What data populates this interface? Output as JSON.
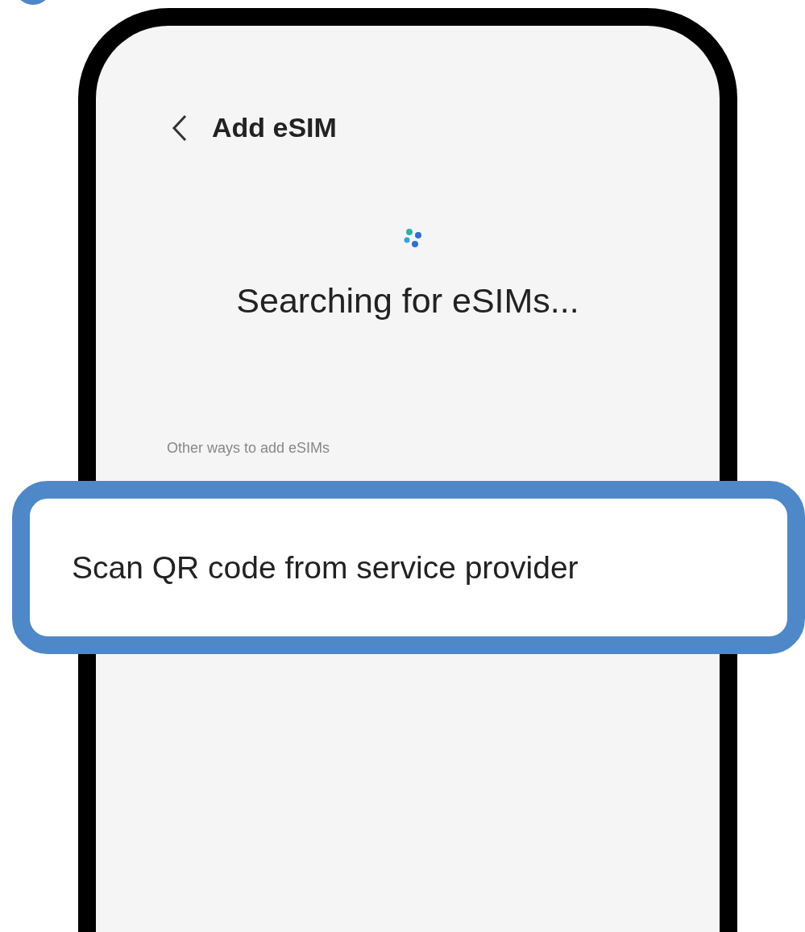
{
  "header": {
    "title": "Add eSIM"
  },
  "status": {
    "text": "Searching for eSIMs..."
  },
  "section": {
    "label": "Other ways to add eSIMs"
  },
  "options": [
    {
      "label": "Scan QR code from service provider",
      "highlighted": true
    }
  ]
}
